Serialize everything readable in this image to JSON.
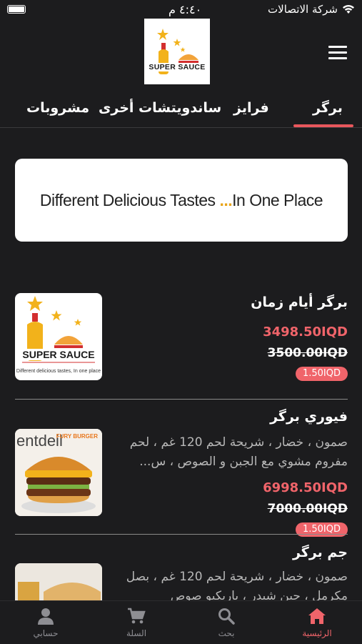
{
  "status_bar": {
    "time": "٤:٤٠ م",
    "carrier": "شركة الاتصالات"
  },
  "tabs": [
    {
      "label": "برگر",
      "active": true
    },
    {
      "label": "فرايز",
      "active": false
    },
    {
      "label": "ساندويتشات أخرى",
      "active": false
    },
    {
      "label": "مشروبات",
      "active": false
    }
  ],
  "logo_text": "SUPER SAUCE",
  "banner": {
    "text_part1": "Different Delicious Tastes",
    "dots": "...",
    "text_part2": "In One Place"
  },
  "products": [
    {
      "title": "برگر أيام زمان",
      "description": "",
      "price": "3498.50IQD",
      "old_price": "3500.00IQD",
      "discount": "1.50IQD",
      "image_caption": "Different delicious tastes, In one place"
    },
    {
      "title": "فيوري برگر",
      "description": "صمون ، خضار ، شريحة لحم 120 غم ، لحم مفروم مشوي مع الجبن و الصوص ، س...",
      "price": "6998.50IQD",
      "old_price": "7000.00IQD",
      "discount": "1.50IQD",
      "image_caption": "FURY BURGER"
    },
    {
      "title": "جم برگر",
      "description": "صمون ، خضار ، شريحة لحم 120 غم ، بصل مكرمل ، جبن شيدر ، باربكيو صوص",
      "price": "",
      "old_price": "",
      "discount": ""
    }
  ],
  "bottom_nav": [
    {
      "label": "الرئيسية",
      "icon": "home-icon",
      "active": true
    },
    {
      "label": "بحث",
      "icon": "search-icon",
      "active": false
    },
    {
      "label": "السلة",
      "icon": "cart-icon",
      "active": false
    },
    {
      "label": "حسابي",
      "icon": "person-icon",
      "active": false
    }
  ],
  "colors": {
    "background": "#1c1c1e",
    "accent": "#f0646a",
    "tab_underline": "#e8575c",
    "logo_yellow": "#f2b21b",
    "logo_red": "#d32f2f"
  }
}
